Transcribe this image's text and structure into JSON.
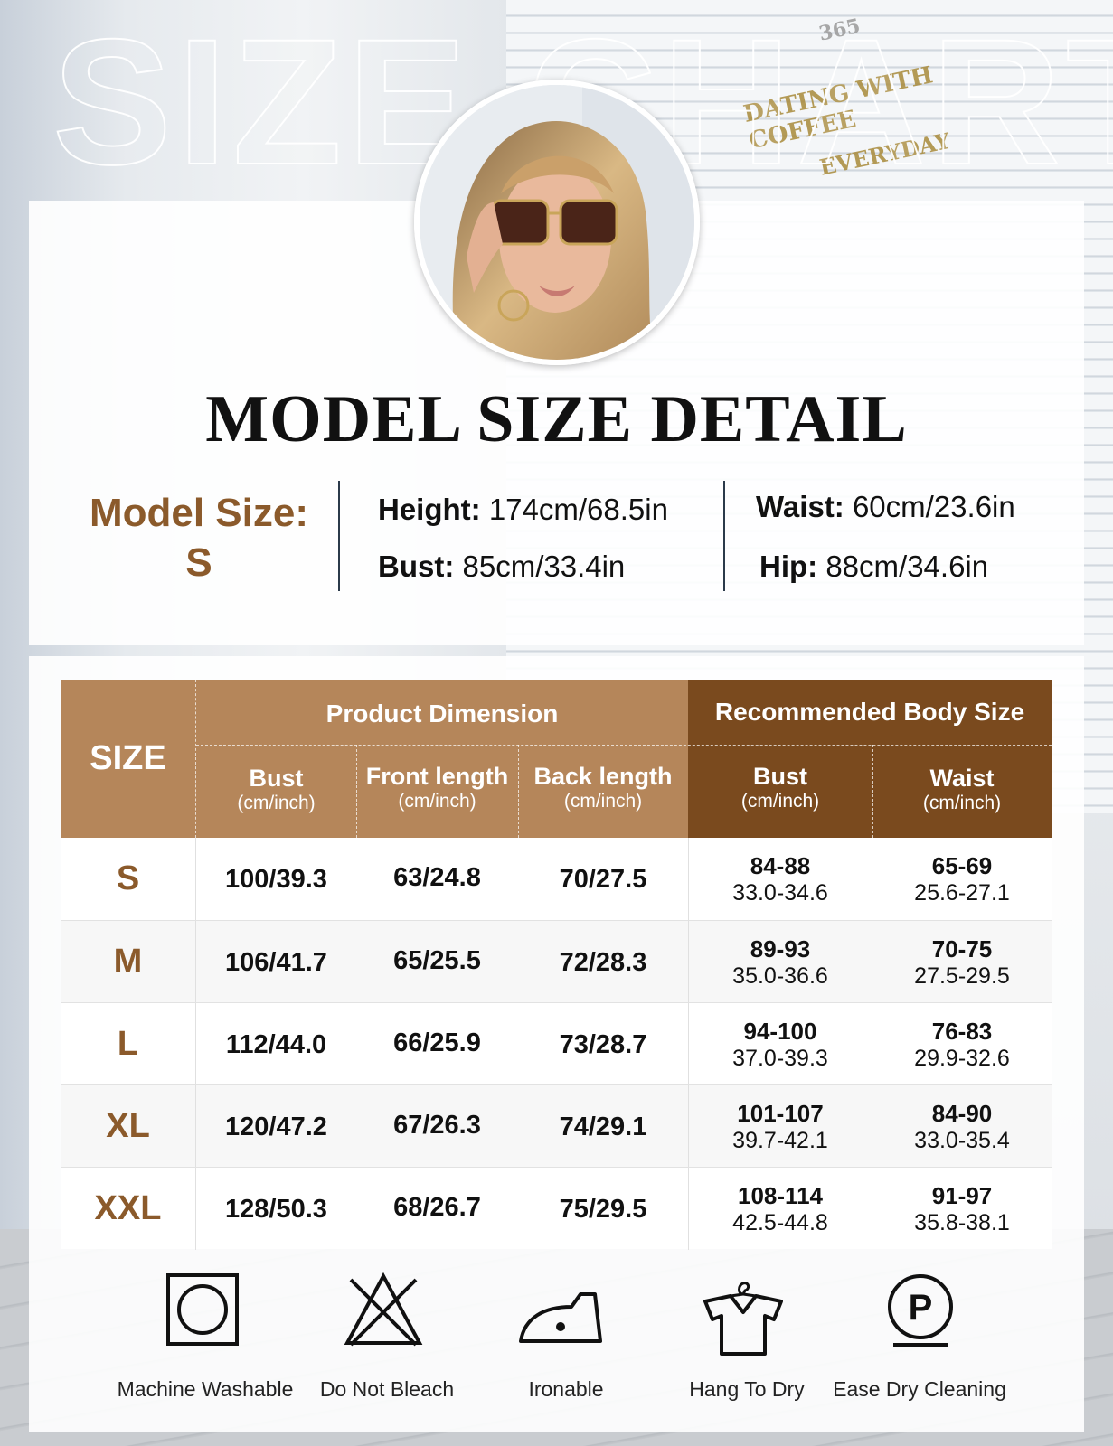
{
  "background_title": "SIZE CHART",
  "sign": {
    "line1": "365",
    "line2": "DATING WITH COFFEE",
    "line3": "EVERYDAY"
  },
  "model_section": {
    "title": "MODEL SIZE DETAIL",
    "model_size_label": "Model Size:",
    "model_size_value": "S",
    "height_label": "Height:",
    "height_value": "174cm/68.5in",
    "bust_label": "Bust:",
    "bust_value": "85cm/33.4in",
    "waist_label": "Waist:",
    "waist_value": "60cm/23.6in",
    "hip_label": "Hip:",
    "hip_value": "88cm/34.6in"
  },
  "table": {
    "size_header": "SIZE",
    "product_group": "Product Dimension",
    "recommended_group": "Recommended Body Size",
    "unit": "(cm/inch)",
    "columns": [
      "Bust",
      "Front length",
      "Back length",
      "Bust",
      "Waist"
    ],
    "rows": [
      {
        "size": "S",
        "bust": "100/39.3",
        "front": "63/24.8",
        "back": "70/27.5",
        "rb_cm": "84-88",
        "rb_in": "33.0-34.6",
        "rw_cm": "65-69",
        "rw_in": "25.6-27.1"
      },
      {
        "size": "M",
        "bust": "106/41.7",
        "front": "65/25.5",
        "back": "72/28.3",
        "rb_cm": "89-93",
        "rb_in": "35.0-36.6",
        "rw_cm": "70-75",
        "rw_in": "27.5-29.5"
      },
      {
        "size": "L",
        "bust": "112/44.0",
        "front": "66/25.9",
        "back": "73/28.7",
        "rb_cm": "94-100",
        "rb_in": "37.0-39.3",
        "rw_cm": "76-83",
        "rw_in": "29.9-32.6"
      },
      {
        "size": "XL",
        "bust": "120/47.2",
        "front": "67/26.3",
        "back": "74/29.1",
        "rb_cm": "101-107",
        "rb_in": "39.7-42.1",
        "rw_cm": "84-90",
        "rw_in": "33.0-35.4"
      },
      {
        "size": "XXL",
        "bust": "128/50.3",
        "front": "68/26.7",
        "back": "75/29.5",
        "rb_cm": "108-114",
        "rb_in": "42.5-44.8",
        "rw_cm": "91-97",
        "rw_in": "35.8-38.1"
      }
    ]
  },
  "care": [
    {
      "label": "Machine Washable",
      "icon": "machine-wash-icon"
    },
    {
      "label": "Do Not Bleach",
      "icon": "no-bleach-icon"
    },
    {
      "label": "Ironable",
      "icon": "iron-icon"
    },
    {
      "label": "Hang To Dry",
      "icon": "hang-dry-icon"
    },
    {
      "label": "Ease Dry Cleaning",
      "icon": "dry-clean-icon"
    }
  ],
  "colors": {
    "product_header": "#b5865a",
    "recommended_header": "#7a4a1e",
    "size_text": "#8b5a2b",
    "brand_brown": "#8b5a2b"
  }
}
